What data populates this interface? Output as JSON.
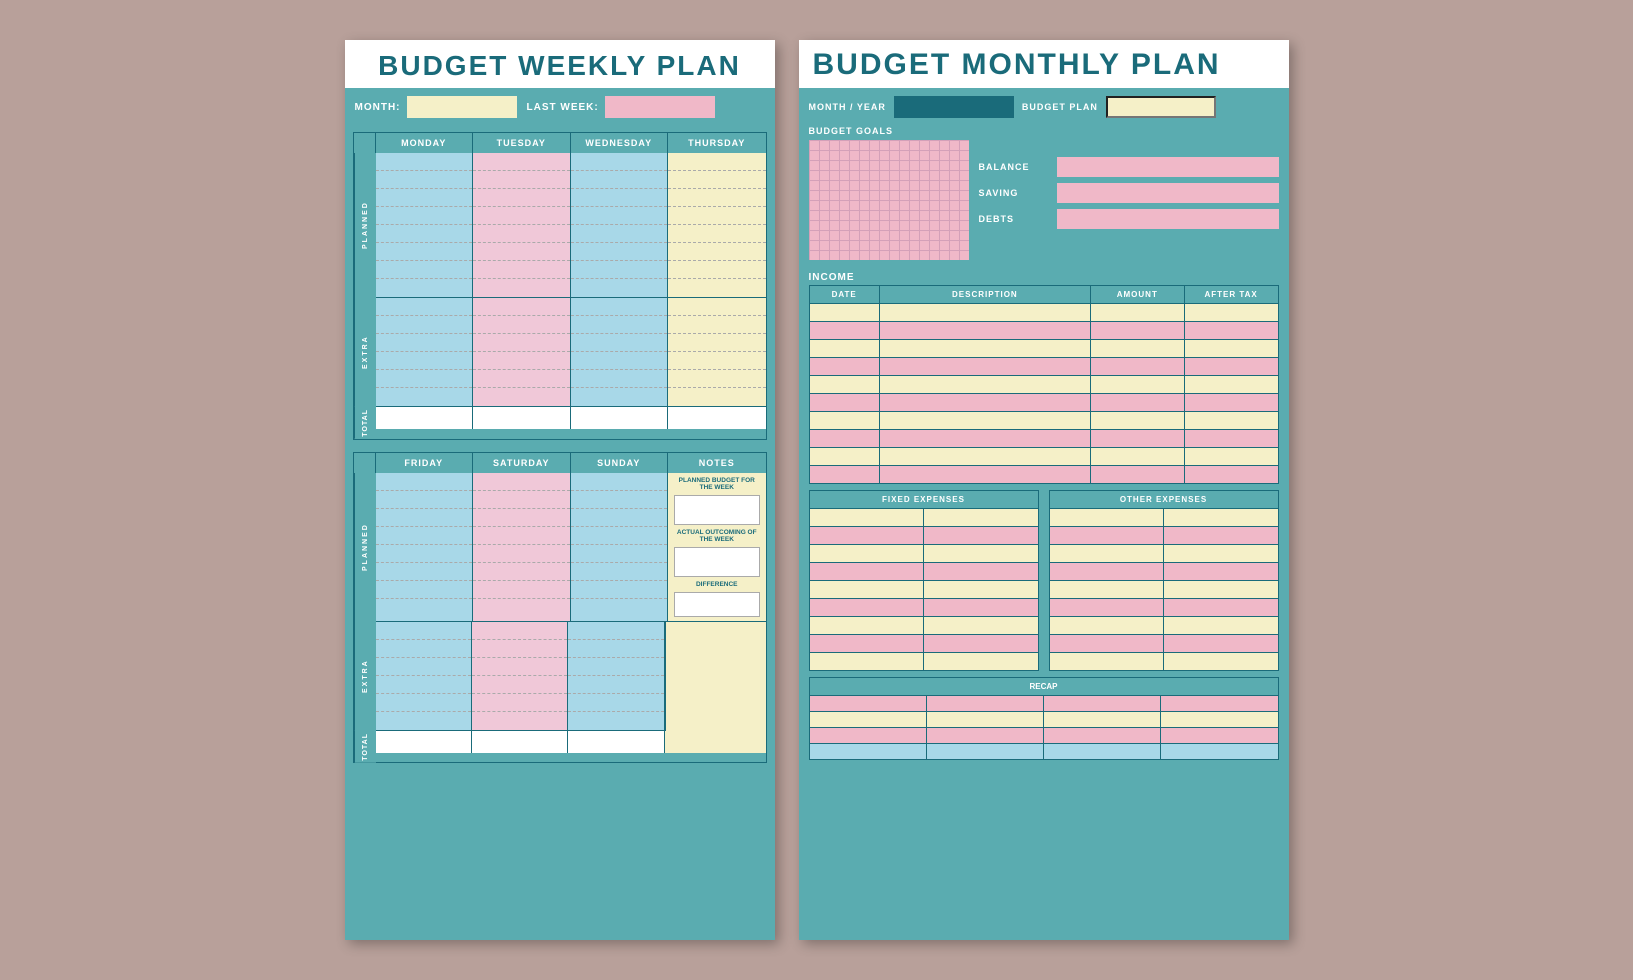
{
  "weekly": {
    "title": "BUDGET WEEKLY PLAN",
    "month_label": "MONTH:",
    "last_week_label": "LAST WEEK:",
    "days_top": [
      "MONDAY",
      "TUESDAY",
      "WEDNESDAY",
      "THURSDAY"
    ],
    "days_bottom": [
      "FRIDAY",
      "SATURDAY",
      "SUNDAY",
      "NOTES"
    ],
    "row_labels": [
      "PLANNED",
      "EXTRA",
      "TOTAL"
    ],
    "planned_label": "PLANNED",
    "extra_label": "EXTRA",
    "total_label": "TOTAL",
    "planned_budget_label": "PLANNED BUDGET FOR THE WEEK",
    "actual_outcoming_label": "ACTUAL OUTCOMING OF THE WEEK",
    "difference_label": "DIFFERENCE"
  },
  "monthly": {
    "title": "BUDGET MONTHLY PLAN",
    "month_year_label": "MONTH / YEAR",
    "budget_plan_label": "BUDGET PLAN",
    "budget_goals_label": "BUDGET GOALS",
    "balance_label": "BALANCE",
    "saving_label": "SAVING",
    "debts_label": "DEBTS",
    "income_label": "INCOME",
    "columns": [
      "DATE",
      "DESCRIPTION",
      "AMOUNT",
      "AFTER TAX"
    ],
    "fixed_expenses_label": "FIXED EXPENSES",
    "other_expenses_label": "OTHER EXPENSES",
    "recap_label": "RECAP"
  }
}
